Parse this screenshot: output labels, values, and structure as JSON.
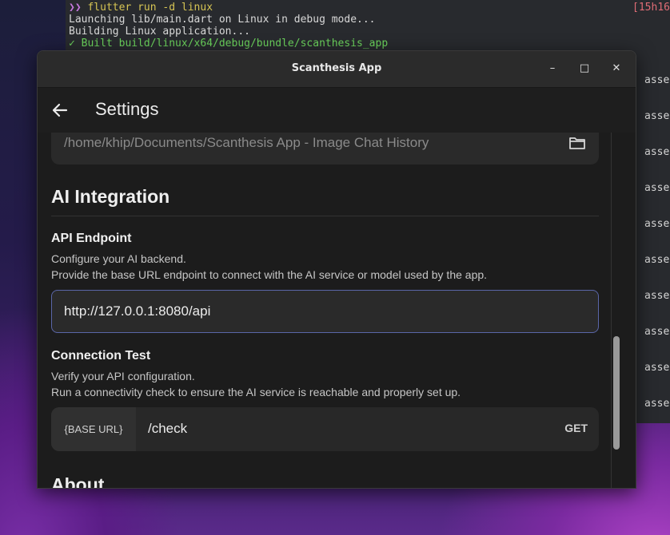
{
  "terminal": {
    "prompt_symbol": "❯❯",
    "command": "flutter run -d linux",
    "lines": [
      "Launching lib/main.dart on Linux in debug mode...",
      "Building Linux application..."
    ],
    "built_mark": "✓",
    "built_line": "Built build/linux/x64/debug/bundle/scanthesis_app",
    "time_fragment": "[15h16",
    "asset_fragment": "asse"
  },
  "window": {
    "title": "Scanthesis App",
    "minimize_glyph": "–",
    "maximize_glyph": "□",
    "close_glyph": "✕"
  },
  "appbar": {
    "title": "Settings"
  },
  "storage": {
    "path_value": "/home/khip/Documents/Scanthesis App - Image Chat History"
  },
  "ai_integration": {
    "section_title": "AI Integration",
    "api_endpoint": {
      "title": "API Endpoint",
      "desc_line1": "Configure your AI backend.",
      "desc_line2": "Provide the base URL endpoint to connect with the AI service or model used by the app.",
      "value": "http://127.0.0.1:8080/api"
    },
    "connection_test": {
      "title": "Connection Test",
      "desc_line1": "Verify your API configuration.",
      "desc_line2": "Run a connectivity check to ensure the AI service is reachable and properly set up.",
      "base_label": "{BASE URL}",
      "path": "/check",
      "method_label": "GET"
    }
  },
  "about": {
    "section_title": "About"
  },
  "colors": {
    "accent_border": "#5a66a8",
    "window_bg": "#1c1c1c",
    "terminal_bg": "#282a2e"
  }
}
